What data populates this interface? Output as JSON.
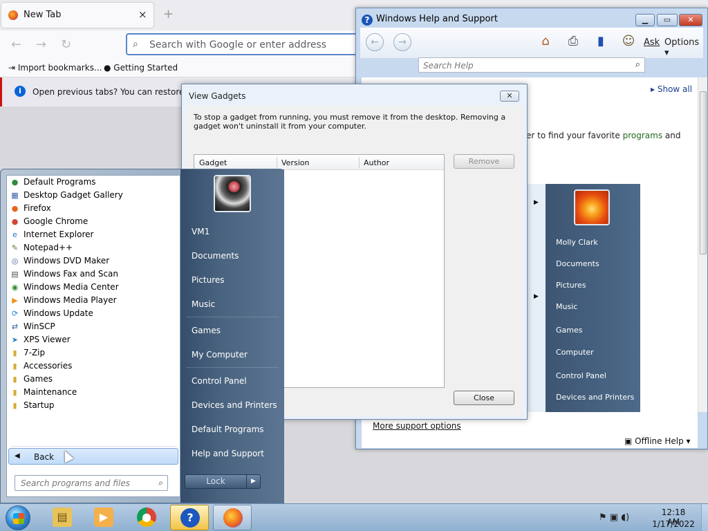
{
  "firefox": {
    "tab_title": "New Tab",
    "tab_close": "×",
    "new_tab": "+",
    "url_placeholder": "Search with Google or enter address",
    "bookmarks": [
      "Import bookmarks...",
      "Getting Started"
    ],
    "restore_notice": "Open previous tabs? You can restore your"
  },
  "help": {
    "title": "Windows Help and Support",
    "ask": "Ask",
    "options": "Options",
    "search_placeholder": "Search Help",
    "show_all": "Show all",
    "content_text": "er to find your favorite",
    "content_link": "programs",
    "content_tail": "and",
    "more_support": "More support options",
    "offline_help": "Offline Help",
    "mini_start_items": [
      "Molly Clark",
      "Documents",
      "Pictures",
      "Music",
      "Games",
      "Computer",
      "Control Panel",
      "Devices and Printers"
    ]
  },
  "gadgets": {
    "title": "View Gadgets",
    "description": "To stop a gadget from running, you must remove it from the desktop. Removing a gadget won't uninstall it from your computer.",
    "columns": [
      "Gadget",
      "Version",
      "Author"
    ],
    "remove_label": "Remove",
    "close_label": "Close"
  },
  "start_menu": {
    "programs": [
      {
        "label": "Default Programs",
        "icon": "default-programs-icon"
      },
      {
        "label": "Desktop Gadget Gallery",
        "icon": "gadget-icon"
      },
      {
        "label": "Firefox",
        "icon": "firefox-icon"
      },
      {
        "label": "Google Chrome",
        "icon": "chrome-icon"
      },
      {
        "label": "Internet Explorer",
        "icon": "ie-icon"
      },
      {
        "label": "Notepad++",
        "icon": "notepad-icon"
      },
      {
        "label": "Windows DVD Maker",
        "icon": "dvd-icon"
      },
      {
        "label": "Windows Fax and Scan",
        "icon": "fax-icon"
      },
      {
        "label": "Windows Media Center",
        "icon": "media-center-icon"
      },
      {
        "label": "Windows Media Player",
        "icon": "media-player-icon"
      },
      {
        "label": "Windows Update",
        "icon": "update-icon"
      },
      {
        "label": "WinSCP",
        "icon": "winscp-icon"
      },
      {
        "label": "XPS Viewer",
        "icon": "xps-icon"
      },
      {
        "label": "7-Zip",
        "icon": "folder-icon"
      },
      {
        "label": "Accessories",
        "icon": "folder-icon"
      },
      {
        "label": "Games",
        "icon": "folder-icon"
      },
      {
        "label": "Maintenance",
        "icon": "folder-icon"
      },
      {
        "label": "Startup",
        "icon": "folder-icon"
      }
    ],
    "back_label": "Back",
    "search_placeholder": "Search programs and files",
    "right_items": [
      "VM1",
      "Documents",
      "Pictures",
      "Music",
      "Games",
      "My Computer",
      "Control Panel",
      "Devices and Printers",
      "Default Programs",
      "Help and Support"
    ],
    "lock_label": "Lock"
  },
  "taskbar": {
    "time": "12:18 AM",
    "date": "1/17/2022"
  }
}
